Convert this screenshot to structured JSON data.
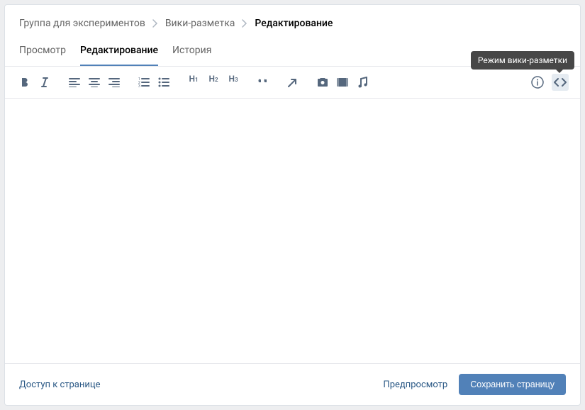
{
  "breadcrumbs": {
    "item0": "Группа для экспериментов",
    "item1": "Вики-разметка",
    "item2": "Редактирование"
  },
  "tabs": {
    "preview": "Просмотр",
    "edit": "Редактирование",
    "history": "История"
  },
  "toolbar": {
    "h1": "H",
    "h2": "H",
    "h3": "H"
  },
  "tooltip": {
    "wiki_mode": "Режим вики-разметки"
  },
  "editor": {
    "content": ""
  },
  "footer": {
    "access": "Доступ к странице",
    "preview": "Предпросмотр",
    "save": "Сохранить страницу"
  }
}
